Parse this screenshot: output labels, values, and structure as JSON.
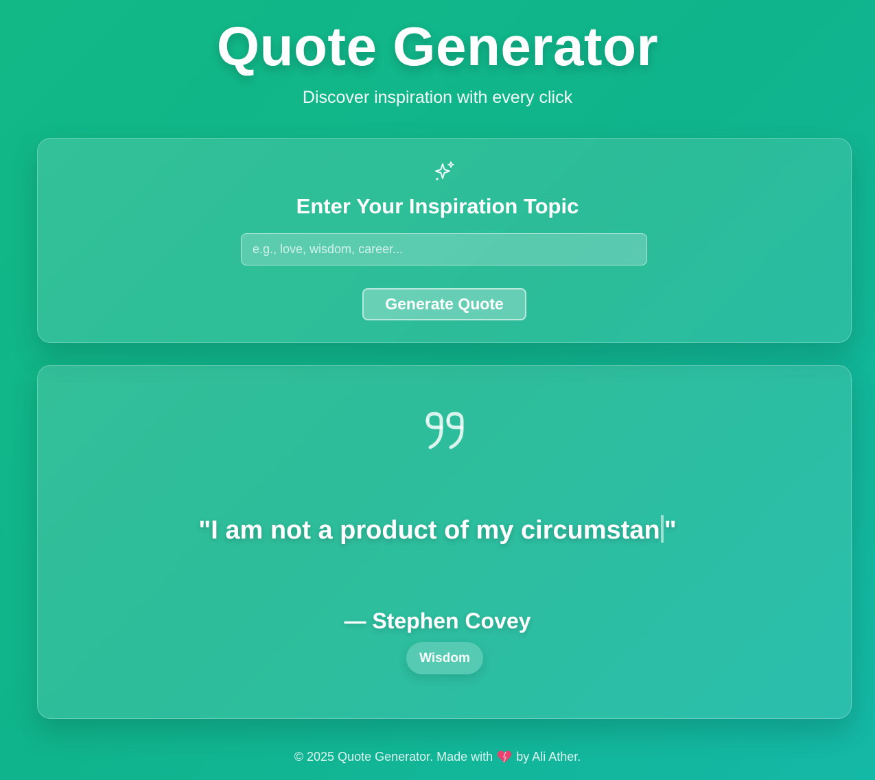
{
  "header": {
    "title": "Quote Generator",
    "subtitle": "Discover inspiration with every click"
  },
  "input_section": {
    "icon": "sparkles-icon",
    "heading": "Enter Your Inspiration Topic",
    "placeholder": "e.g., love, wisdom, career...",
    "value": "",
    "button_label": "Generate Quote"
  },
  "quote_section": {
    "icon": "quote-icon",
    "open_quote": "\"",
    "text_typed": "I am not a product of my circumstan",
    "close_quote": "\"",
    "author": "— Stephen Covey",
    "tag": "Wisdom"
  },
  "footer": {
    "prefix": "© 2025 Quote Generator. Made with",
    "heart_icon": "heart-icon",
    "suffix": "by Ali Ather."
  },
  "colors": {
    "background_start": "#12b886",
    "background_end": "#14b8a6",
    "heart": "#e8436f"
  }
}
